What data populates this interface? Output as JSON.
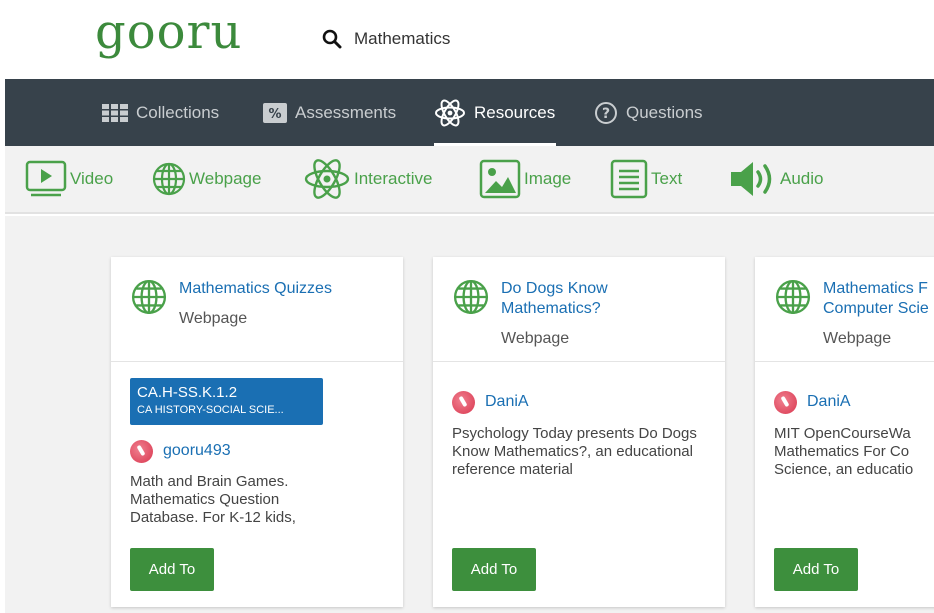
{
  "header": {
    "logo": "gooru",
    "search_query": "Mathematics"
  },
  "nav": {
    "tabs": [
      {
        "label": "Collections",
        "icon": "collections-grid-icon"
      },
      {
        "label": "Assessments",
        "icon": "percent-icon"
      },
      {
        "label": "Resources",
        "icon": "atom-icon",
        "active": true
      },
      {
        "label": "Questions",
        "icon": "question-circle-icon"
      }
    ]
  },
  "filters": [
    {
      "label": "Video",
      "icon": "video-icon"
    },
    {
      "label": "Webpage",
      "icon": "globe-icon"
    },
    {
      "label": "Interactive",
      "icon": "atom-icon"
    },
    {
      "label": "Image",
      "icon": "image-icon"
    },
    {
      "label": "Text",
      "icon": "text-icon"
    },
    {
      "label": "Audio",
      "icon": "audio-icon"
    }
  ],
  "cards": [
    {
      "title": "Mathematics Quizzes",
      "type": "Webpage",
      "standard_code": "CA.H-SS.K.1.2",
      "standard_desc": "CA HISTORY-SOCIAL SCIE...",
      "author": "gooru493",
      "description": "Math and Brain Games. Mathematics Question Database. For K-12 kids,",
      "button": "Add To"
    },
    {
      "title_line1": "Do Dogs Know",
      "title_line2": "Mathematics?",
      "type": "Webpage",
      "author": "DaniA",
      "description": "Psychology Today presents Do Dogs Know Mathematics?, an educational reference material",
      "button": "Add To"
    },
    {
      "title_line1": "Mathematics F",
      "title_line2": "Computer Scie",
      "type": "Webpage",
      "author": "DaniA",
      "description_line1": "MIT OpenCourseWa",
      "description_line2": "Mathematics For Co",
      "description_line3": "Science, an educatio",
      "button": "Add To"
    }
  ]
}
